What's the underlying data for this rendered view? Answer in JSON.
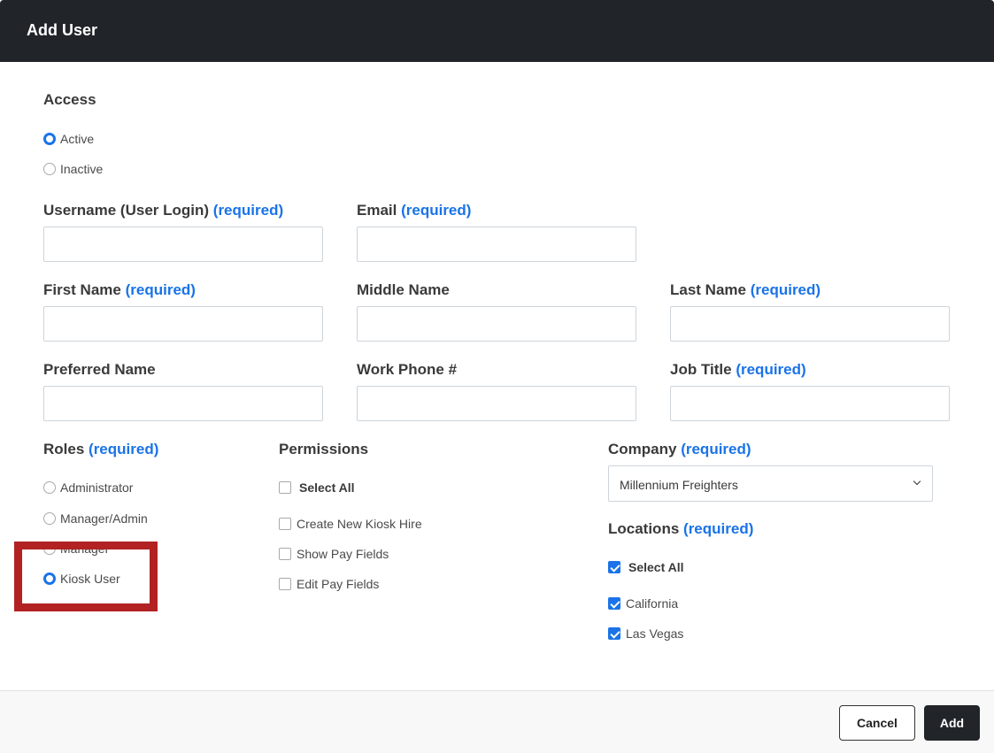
{
  "modal": {
    "title": "Add User"
  },
  "access": {
    "label": "Access",
    "options": [
      {
        "label": "Active",
        "checked": true
      },
      {
        "label": "Inactive",
        "checked": false
      }
    ]
  },
  "required_text": "(required)",
  "fields": {
    "username": {
      "label": "Username (User Login)",
      "value": ""
    },
    "email": {
      "label": "Email",
      "value": ""
    },
    "first_name": {
      "label": "First Name",
      "value": ""
    },
    "middle_name": {
      "label": "Middle Name",
      "value": ""
    },
    "last_name": {
      "label": "Last Name",
      "value": ""
    },
    "preferred_name": {
      "label": "Preferred Name",
      "value": ""
    },
    "work_phone": {
      "label": "Work Phone #",
      "value": ""
    },
    "job_title": {
      "label": "Job Title",
      "value": ""
    }
  },
  "roles": {
    "label": "Roles",
    "options": [
      {
        "label": "Administrator",
        "checked": false
      },
      {
        "label": "Manager/Admin",
        "checked": false
      },
      {
        "label": "Manager",
        "checked": false
      },
      {
        "label": "Kiosk User",
        "checked": true
      }
    ]
  },
  "permissions": {
    "label": "Permissions",
    "select_all": {
      "label": "Select All",
      "checked": false
    },
    "options": [
      {
        "label": "Create New Kiosk Hire",
        "checked": false
      },
      {
        "label": "Show Pay Fields",
        "checked": false
      },
      {
        "label": "Edit Pay Fields",
        "checked": false
      }
    ]
  },
  "company": {
    "label": "Company",
    "selected": "Millennium Freighters"
  },
  "locations": {
    "label": "Locations",
    "select_all": {
      "label": "Select All",
      "checked": true
    },
    "options": [
      {
        "label": "California",
        "checked": true
      },
      {
        "label": "Las Vegas",
        "checked": true
      }
    ]
  },
  "footer": {
    "cancel_label": "Cancel",
    "add_label": "Add"
  },
  "colors": {
    "header_bg": "#212529",
    "accent": "#1a73e8",
    "highlight": "#b22222"
  }
}
